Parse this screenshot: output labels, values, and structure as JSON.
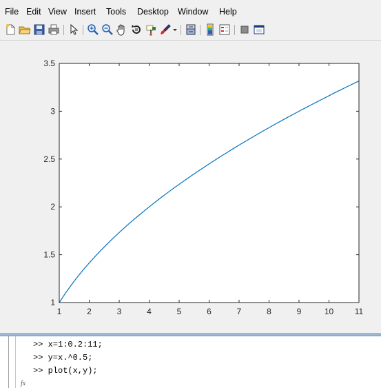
{
  "menu": {
    "items": [
      "File",
      "Edit",
      "View",
      "Insert",
      "Tools",
      "Desktop",
      "Window",
      "Help"
    ]
  },
  "toolbar": {
    "buttons": [
      "new-figure",
      "open-file",
      "save",
      "print",
      "edit-plot",
      "zoom-in",
      "zoom-out",
      "pan",
      "rotate-3d",
      "data-cursor",
      "brush",
      "link-plot",
      "insert-colorbar",
      "insert-legend",
      "hide-plot-tools",
      "show-plot-tools"
    ]
  },
  "colors": {
    "line": "#0072bd",
    "axes": "#262626",
    "figure_bg": "#f0f0f0"
  },
  "chart_data": {
    "type": "line",
    "title": "",
    "xlabel": "",
    "ylabel": "",
    "xlim": [
      1,
      11
    ],
    "ylim": [
      1,
      3.5
    ],
    "xticks": [
      1,
      2,
      3,
      4,
      5,
      6,
      7,
      8,
      9,
      10,
      11
    ],
    "yticks": [
      1,
      1.5,
      2,
      2.5,
      3,
      3.5
    ],
    "xtick_labels": [
      "1",
      "2",
      "3",
      "4",
      "5",
      "6",
      "7",
      "8",
      "9",
      "10",
      "11"
    ],
    "ytick_labels": [
      "1",
      "1.5",
      "2",
      "2.5",
      "3",
      "3.5"
    ],
    "grid": false,
    "series": [
      {
        "x": [
          1,
          1.2,
          1.4,
          1.6,
          1.8,
          2,
          2.2,
          2.4,
          2.6,
          2.8,
          3,
          3.2,
          3.4,
          3.6,
          3.8,
          4,
          4.2,
          4.4,
          4.6,
          4.8,
          5,
          5.2,
          5.4,
          5.6,
          5.8,
          6,
          6.2,
          6.4,
          6.6,
          6.8,
          7,
          7.2,
          7.4,
          7.6,
          7.8,
          8,
          8.2,
          8.4,
          8.6,
          8.8,
          9,
          9.2,
          9.4,
          9.6,
          9.8,
          10,
          10.2,
          10.4,
          10.6,
          10.8,
          11
        ],
        "y": [
          1,
          1.095,
          1.183,
          1.265,
          1.342,
          1.414,
          1.483,
          1.549,
          1.612,
          1.673,
          1.732,
          1.789,
          1.844,
          1.897,
          1.949,
          2,
          2.049,
          2.098,
          2.145,
          2.191,
          2.236,
          2.28,
          2.324,
          2.366,
          2.408,
          2.449,
          2.49,
          2.53,
          2.569,
          2.608,
          2.646,
          2.683,
          2.72,
          2.757,
          2.793,
          2.828,
          2.864,
          2.898,
          2.933,
          2.966,
          3,
          3.033,
          3.066,
          3.098,
          3.13,
          3.162,
          3.194,
          3.225,
          3.256,
          3.286,
          3.317
        ]
      }
    ]
  },
  "command_window": {
    "lines": [
      ">> x=1:0.2:11;",
      ">> y=x.^0.5;",
      ">> plot(x,y);"
    ],
    "fx": "fx"
  }
}
